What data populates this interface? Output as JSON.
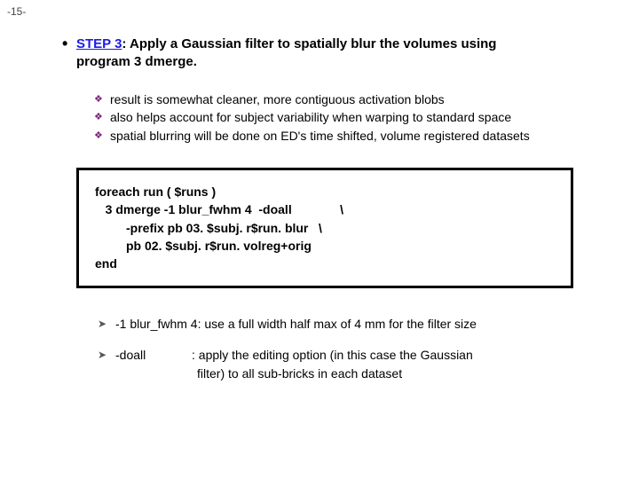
{
  "page_number": "-15-",
  "step": {
    "label": "STEP 3",
    "text_line1": ": Apply a Gaussian filter to spatially blur the volumes using",
    "text_line2": "program 3 dmerge."
  },
  "sub_points": [
    "result is somewhat cleaner, more contiguous activation blobs",
    "also helps account for subject variability when warping to standard space",
    "spatial blurring will be done on ED's time shifted, volume registered datasets"
  ],
  "code": {
    "l1": "foreach run ( $runs )",
    "l2": "   3 dmerge -1 blur_fwhm 4  -doall              \\",
    "l3": "         -prefix pb 03. $subj. r$run. blur   \\",
    "l4": "         pb 02. $subj. r$run. volreg+orig",
    "l5": "end"
  },
  "options": [
    {
      "key": "-1 blur_fwhm 4",
      "desc": ": use a full width half max of 4 mm for the filter size"
    },
    {
      "key": "-doall",
      "desc_l1": ": apply the editing option (in this case the Gaussian",
      "desc_l2": "filter) to all sub-bricks in each dataset"
    }
  ]
}
